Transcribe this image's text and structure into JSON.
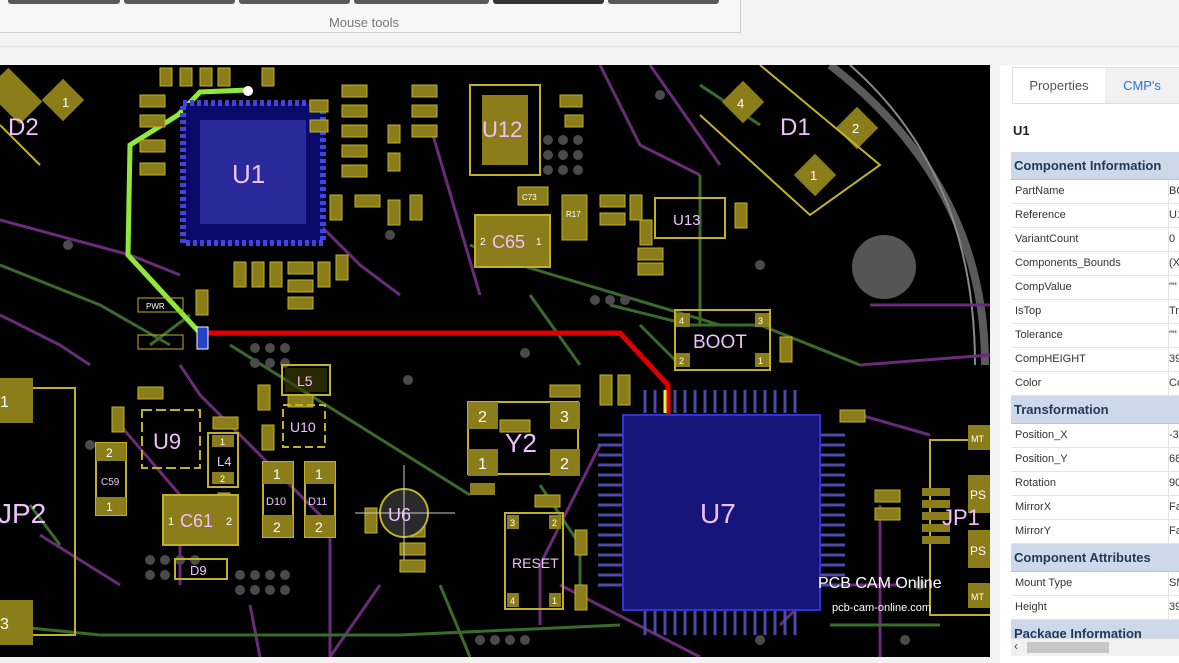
{
  "toolbar": {
    "label": "Mouse tools"
  },
  "canvas": {
    "watermark_title": "PCB CAM Online",
    "watermark_url": "pcb-cam-online.com",
    "components": {
      "D2": "D2",
      "D1": "D1",
      "U1": "U1",
      "U12": "U12",
      "C65": "C65",
      "U13": "U13",
      "BOOT": "BOOT",
      "L5": "L5",
      "U9": "U9",
      "U10": "U10",
      "L4": "L4",
      "C59": "C59",
      "Y2": "Y2",
      "U7": "U7",
      "JP2": "JP2",
      "C61": "C61",
      "D10": "D10",
      "D11": "D11",
      "U6": "U6",
      "RESET": "RESET",
      "D9": "D9",
      "JP1": "JP1"
    },
    "pads": {
      "d2_1": "1",
      "d1_1": "1",
      "d1_2": "2",
      "d1_4": "4",
      "y2_2": "2",
      "y2_3": "3",
      "y2_1": "1",
      "y2_2b": "2",
      "jp2_1": "1",
      "jp2_3": "3",
      "c65_1": "1",
      "c65_2": "2",
      "c61_1": "1",
      "c61_2": "2",
      "d10_1": "1",
      "d10_2": "2",
      "d11_1": "1",
      "d11_2": "2",
      "c59_2": "2",
      "c59_1": "1",
      "boot_4": "4",
      "boot_3": "3",
      "boot_2": "2",
      "boot_1": "1",
      "l4_1": "1",
      "l4_2": "2",
      "reset_3": "3",
      "reset_2": "2",
      "reset_4": "4",
      "reset_1": "1",
      "r17": "R17",
      "c73": "C73",
      "pwr": "PWR",
      "mt1": "MT",
      "mt2": "MT",
      "ps1": "PS",
      "ps2": "PS"
    }
  },
  "panel": {
    "tabs": [
      "Properties",
      "CMP's"
    ],
    "selected": "U1",
    "sections": [
      {
        "title": "Component Information",
        "rows": [
          {
            "key": "PartName",
            "value": "BC"
          },
          {
            "key": "Reference",
            "value": "U1"
          },
          {
            "key": "VariantCount",
            "value": "0"
          },
          {
            "key": "Components_Bounds",
            "value": "(X="
          },
          {
            "key": "CompValue",
            "value": "\"\""
          },
          {
            "key": "IsTop",
            "value": "Tr"
          },
          {
            "key": "Tolerance",
            "value": "\"\""
          },
          {
            "key": "CompHEIGHT",
            "value": "39"
          },
          {
            "key": "Color",
            "value": "Co"
          }
        ]
      },
      {
        "title": "Transformation",
        "rows": [
          {
            "key": "Position_X",
            "value": "-3"
          },
          {
            "key": "Position_Y",
            "value": "68"
          },
          {
            "key": "Rotation",
            "value": "90"
          },
          {
            "key": "MirrorX",
            "value": "Fa"
          },
          {
            "key": "MirrorY",
            "value": "Fa"
          }
        ]
      },
      {
        "title": "Component Attributes",
        "rows": [
          {
            "key": "Mount Type",
            "value": "SM"
          },
          {
            "key": "Height",
            "value": "39"
          }
        ]
      },
      {
        "title": "Package Information",
        "rows": []
      }
    ],
    "scroll_left_icon": "chevron-left-icon"
  }
}
